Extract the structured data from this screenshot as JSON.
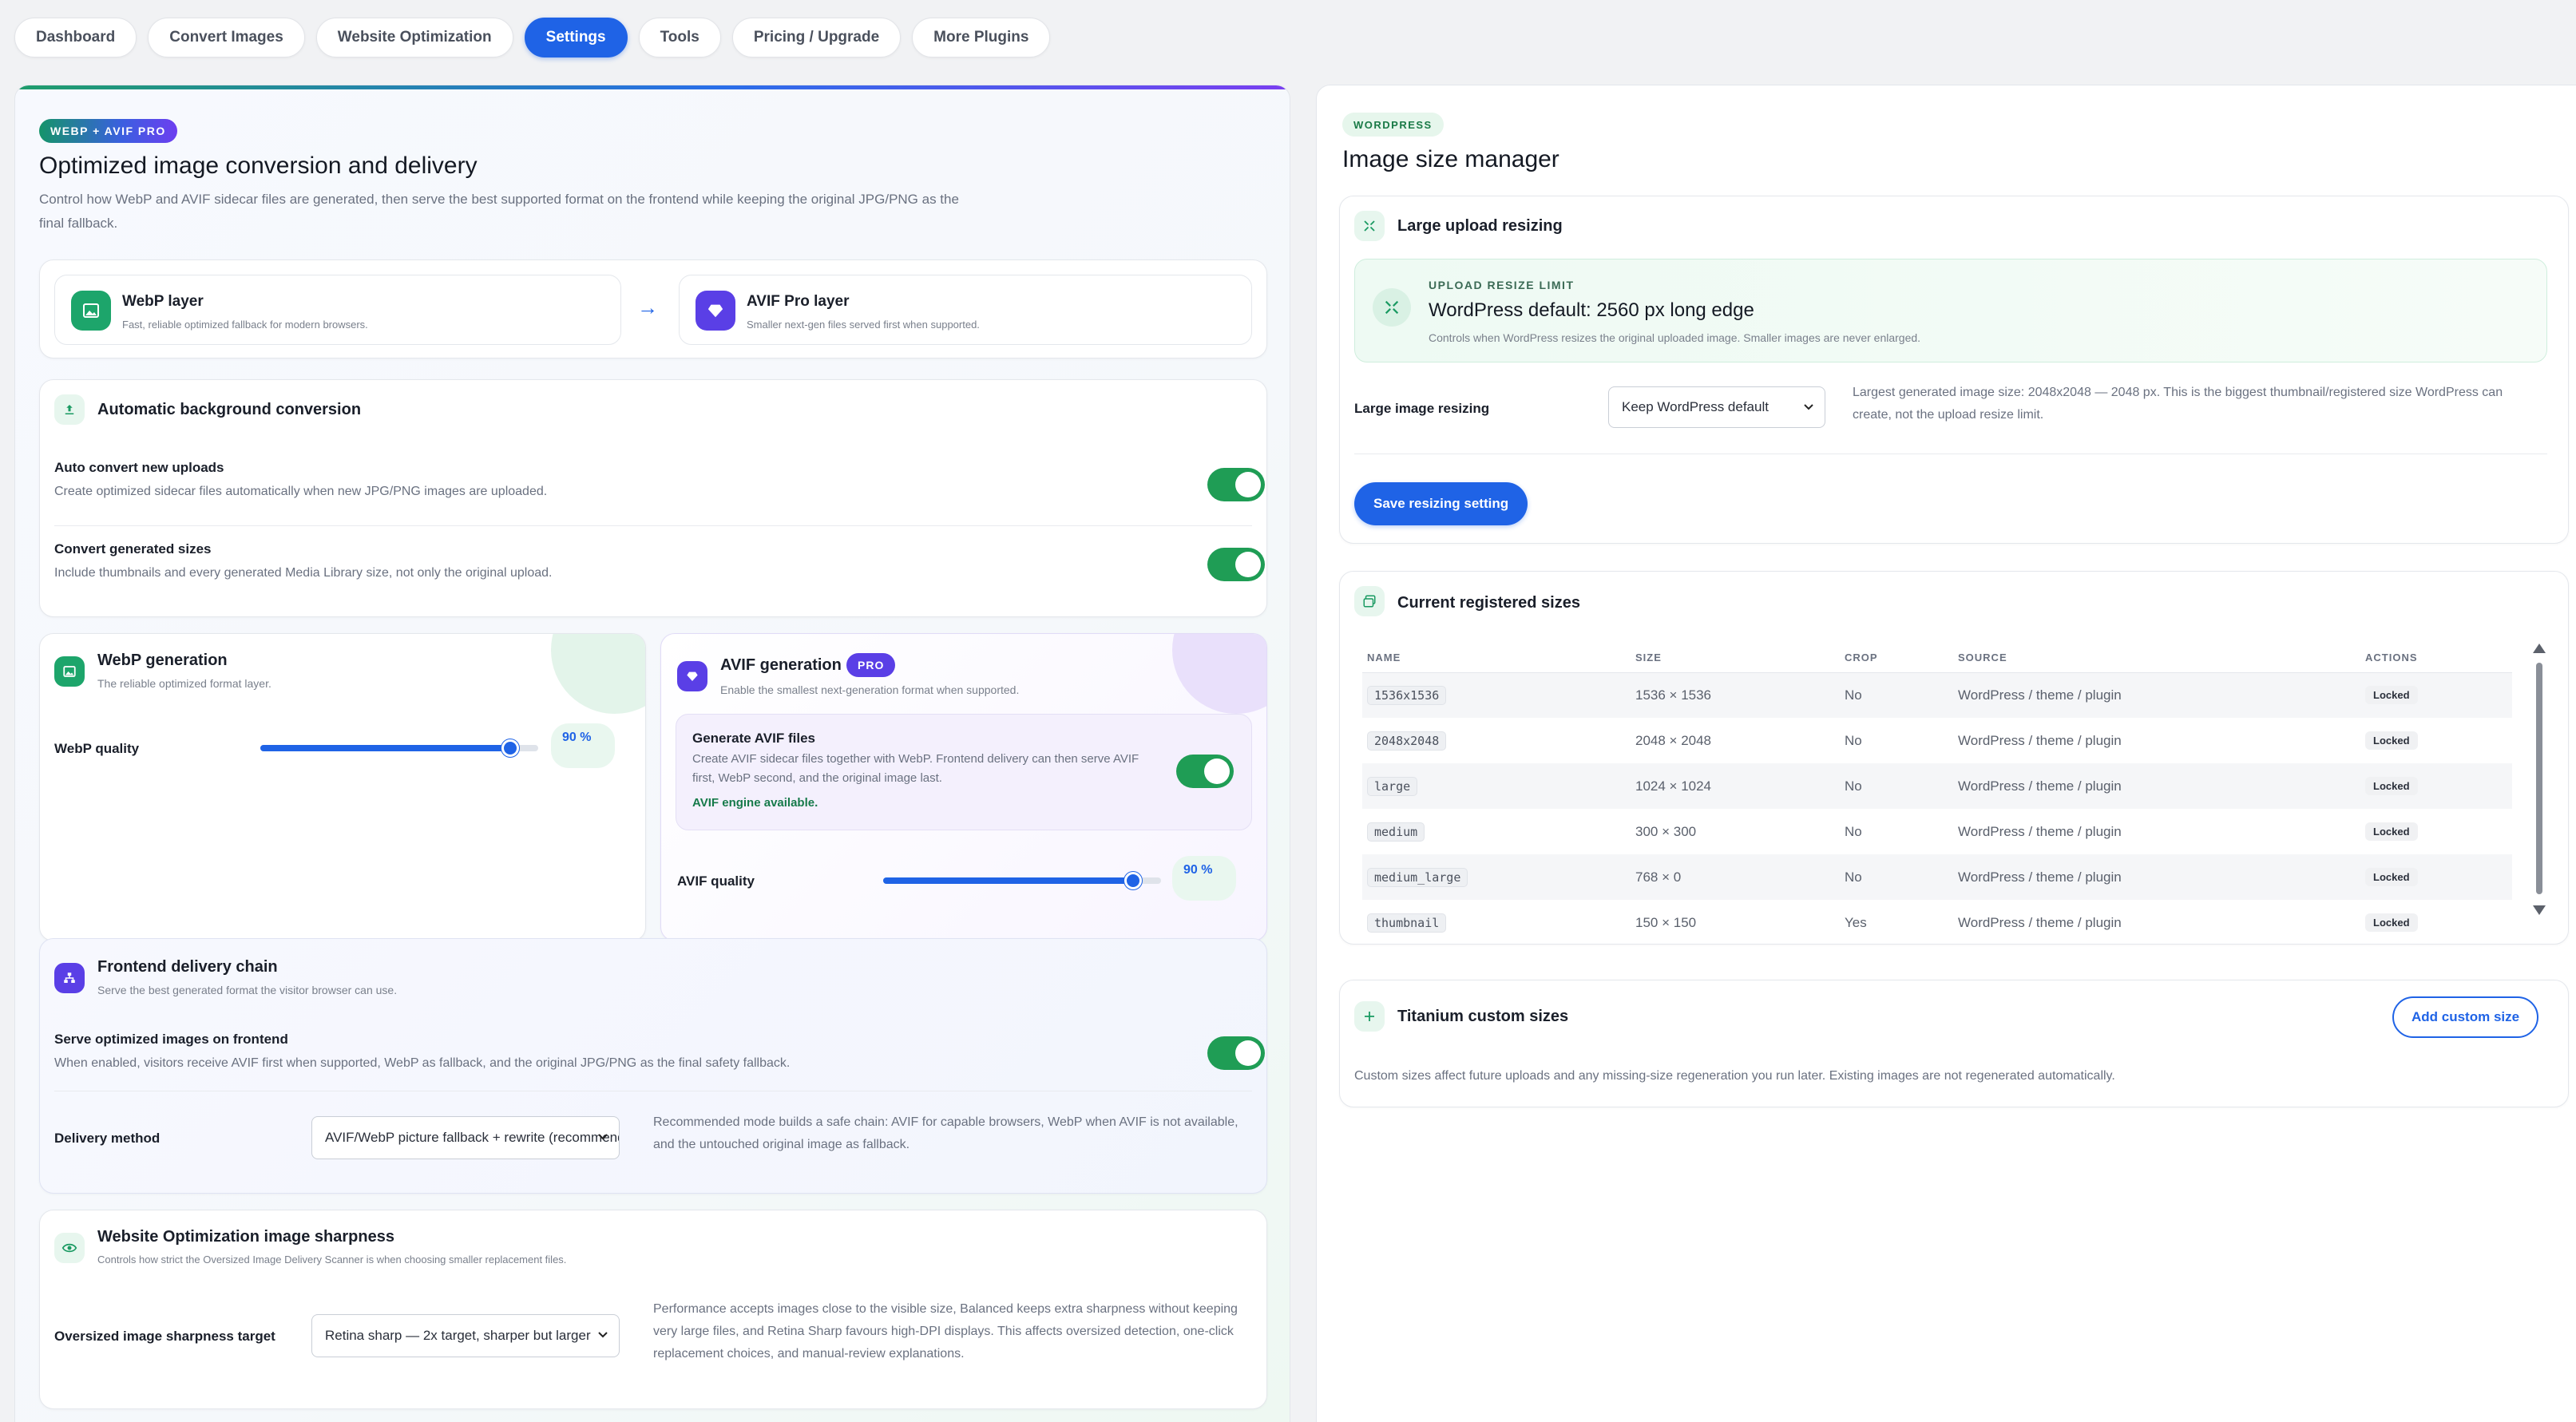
{
  "nav": {
    "tabs": [
      {
        "label": "Dashboard"
      },
      {
        "label": "Convert Images"
      },
      {
        "label": "Website Optimization"
      },
      {
        "label": "Settings",
        "active": true
      },
      {
        "label": "Tools"
      },
      {
        "label": "Pricing / Upgrade"
      },
      {
        "label": "More Plugins"
      }
    ]
  },
  "colors": {
    "accent": "#1f63e6",
    "success": "#1f9d55",
    "pro": "#5a3fe6"
  },
  "left": {
    "badge": "WEBP + AVIF PRO",
    "title": "Optimized image conversion and delivery",
    "description": "Control how WebP and AVIF sidecar files are generated, then serve the best supported format on the frontend while keeping the original JPG/PNG as the final fallback.",
    "layers": {
      "webp": {
        "title": "WebP layer",
        "desc": "Fast, reliable optimized fallback for modern browsers.",
        "icon": "image-icon"
      },
      "arrow": "→",
      "avif": {
        "title": "AVIF Pro layer",
        "desc": "Smaller next-gen files served first when supported.",
        "icon": "gem-icon"
      }
    },
    "auto": {
      "title": "Automatic background conversion",
      "rows": [
        {
          "label": "Auto convert new uploads",
          "help": "Create optimized sidecar files automatically when new JPG/PNG images are uploaded.",
          "on": true
        },
        {
          "label": "Convert generated sizes",
          "help": "Include thumbnails and every generated Media Library size, not only the original upload.",
          "on": true
        }
      ]
    },
    "webp_gen": {
      "title": "WebP generation",
      "subtitle": "The reliable optimized format layer.",
      "quality_label": "WebP quality",
      "quality": 90,
      "quality_text": "90 %"
    },
    "avif_gen": {
      "title": "AVIF generation",
      "badge": "PRO",
      "subtitle": "Enable the smallest next-generation format when supported.",
      "files_label": "Generate AVIF files",
      "files_help": "Create AVIF sidecar files together with WebP. Frontend delivery can then serve AVIF first, WebP second, and the original image last.",
      "engine_status": "AVIF engine available.",
      "files_on": true,
      "quality_label": "AVIF quality",
      "quality": 90,
      "quality_text": "90 %"
    },
    "delivery": {
      "title": "Frontend delivery chain",
      "subtitle": "Serve the best generated format the visitor browser can use.",
      "serve_label": "Serve optimized images on frontend",
      "serve_help": "When enabled, visitors receive AVIF first when supported, WebP as fallback, and the original JPG/PNG as the final safety fallback.",
      "serve_on": true,
      "method_label": "Delivery method",
      "method_value": "AVIF/WebP picture fallback + rewrite (recommended)",
      "method_help": "Recommended mode builds a safe chain: AVIF for capable browsers, WebP when AVIF is not available, and the untouched original image as fallback."
    },
    "sharpness": {
      "title": "Website Optimization image sharpness",
      "subtitle": "Controls how strict the Oversized Image Delivery Scanner is when choosing smaller replacement files.",
      "target_label": "Oversized image sharpness target",
      "target_value": "Retina sharp — 2x target, sharper but larger",
      "target_help": "Performance accepts images close to the visible size, Balanced keeps extra sharpness without keeping very large files, and Retina Sharp favours high-DPI displays. This affects oversized detection, one-click replacement choices, and manual-review explanations."
    }
  },
  "right": {
    "badge": "WORDPRESS",
    "title": "Image size manager",
    "resize": {
      "title": "Large upload resizing",
      "limit_kicker": "UPLOAD RESIZE LIMIT",
      "limit_value": "WordPress default: 2560 px long edge",
      "limit_help": "Controls when WordPress resizes the original uploaded image. Smaller images are never enlarged.",
      "field_label": "Large image resizing",
      "field_value": "Keep WordPress default",
      "field_help": "Largest generated image size: 2048x2048 — 2048 px. This is the biggest thumbnail/registered size WordPress can create, not the upload resize limit.",
      "save_label": "Save resizing setting"
    },
    "registered": {
      "title": "Current registered sizes",
      "columns": [
        "NAME",
        "SIZE",
        "CROP",
        "SOURCE",
        "ACTIONS"
      ],
      "rows": [
        {
          "name": "1536x1536",
          "size": "1536 × 1536",
          "crop": "No",
          "source": "WordPress / theme / plugin",
          "action": "Locked"
        },
        {
          "name": "2048x2048",
          "size": "2048 × 2048",
          "crop": "No",
          "source": "WordPress / theme / plugin",
          "action": "Locked"
        },
        {
          "name": "large",
          "size": "1024 × 1024",
          "crop": "No",
          "source": "WordPress / theme / plugin",
          "action": "Locked"
        },
        {
          "name": "medium",
          "size": "300 × 300",
          "crop": "No",
          "source": "WordPress / theme / plugin",
          "action": "Locked"
        },
        {
          "name": "medium_large",
          "size": "768 × 0",
          "crop": "No",
          "source": "WordPress / theme / plugin",
          "action": "Locked"
        },
        {
          "name": "thumbnail",
          "size": "150 × 150",
          "crop": "Yes",
          "source": "WordPress / theme / plugin",
          "action": "Locked"
        }
      ]
    },
    "custom": {
      "title": "Titanium custom sizes",
      "add_label": "Add custom size",
      "help": "Custom sizes affect future uploads and any missing-size regeneration you run later. Existing images are not regenerated automatically."
    }
  }
}
